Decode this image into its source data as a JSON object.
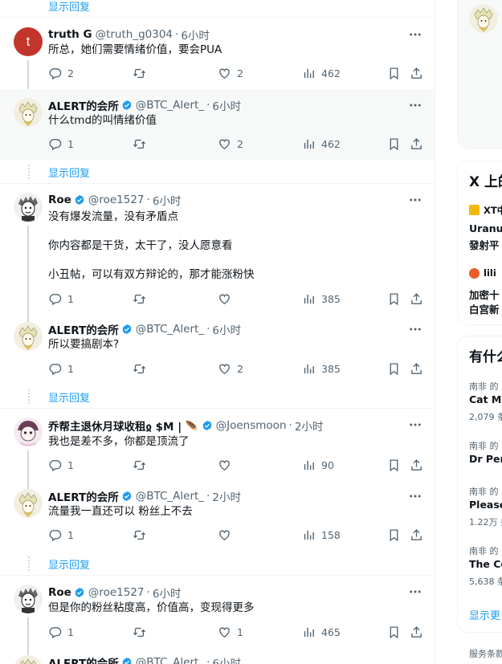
{
  "show_replies_label": "显示回复",
  "tweets": [
    {
      "name": "truth G",
      "handle": "@truth_g0304",
      "time": "6小时",
      "text": "所总，她们需要情绪价值，要会PUA",
      "replies": "2",
      "retweets": "",
      "likes": "2",
      "views": "462"
    },
    {
      "name": "ALERT的会所",
      "handle": "@BTC_Alert_",
      "time": "6小时",
      "text": "什么tmd的叫情绪价值",
      "replies": "1",
      "retweets": "",
      "likes": "2",
      "views": "462"
    },
    {
      "name": "Roe",
      "handle": "@roe1527",
      "time": "6小时",
      "text_lines": [
        "没有爆发流量，没有矛盾点",
        "你内容都是干货，太干了，没人愿意看",
        "小丑帖，可以有双方辩论的，那才能涨粉快"
      ],
      "replies": "1",
      "retweets": "",
      "likes": "",
      "views": "385"
    },
    {
      "name": "ALERT的会所",
      "handle": "@BTC_Alert_",
      "time": "6小时",
      "text": "所以要搞剧本?",
      "replies": "1",
      "retweets": "",
      "likes": "2",
      "views": "385"
    },
    {
      "name": "乔帮主退休月球收租ჲ $M | 🪶",
      "handle": "@Joensmoon",
      "time": "2小时",
      "text": "我也是差不多，你都是顶流了",
      "replies": "1",
      "retweets": "",
      "likes": "",
      "views": "90"
    },
    {
      "name": "ALERT的会所",
      "handle": "@BTC_Alert_",
      "time": "2小时",
      "text": "流量我一直还可以 粉丝上不去",
      "replies": "1",
      "retweets": "",
      "likes": "",
      "views": "158"
    },
    {
      "name": "Roe",
      "handle": "@roe1527",
      "time": "6小时",
      "text": "但是你的粉丝粘度高，价值高，变现得更多",
      "replies": "1",
      "retweets": "",
      "likes": "1",
      "views": "465"
    },
    {
      "name": "ALERT的会所",
      "handle": "@BTC_Alert_",
      "time": "6小时"
    }
  ],
  "avatar_letter": "t",
  "sidebar": {
    "trends_title": "X 上的",
    "news": [
      {
        "source": "XT中",
        "line1": "Uranus",
        "line2": "發射平"
      },
      {
        "source": "lili",
        "line1": "加密十",
        "line2": "白宫新"
      }
    ],
    "whats_title": "有什么",
    "trends": [
      {
        "context": "南非 的",
        "topic": "Cat Ma",
        "count": "2,079 条"
      },
      {
        "context": "南非 的",
        "topic": "Dr Per",
        "count": ""
      },
      {
        "context": "南非 的",
        "topic": "Please",
        "count": "1.22万 条"
      },
      {
        "context": "南非 的",
        "topic": "The Co",
        "count": "5,638 条"
      }
    ],
    "show_more": "显示更",
    "footer": "服务条款"
  },
  "colors": {
    "accent": "#1d9bf0",
    "verified": "#1d9bf0",
    "muted": "#536471"
  }
}
